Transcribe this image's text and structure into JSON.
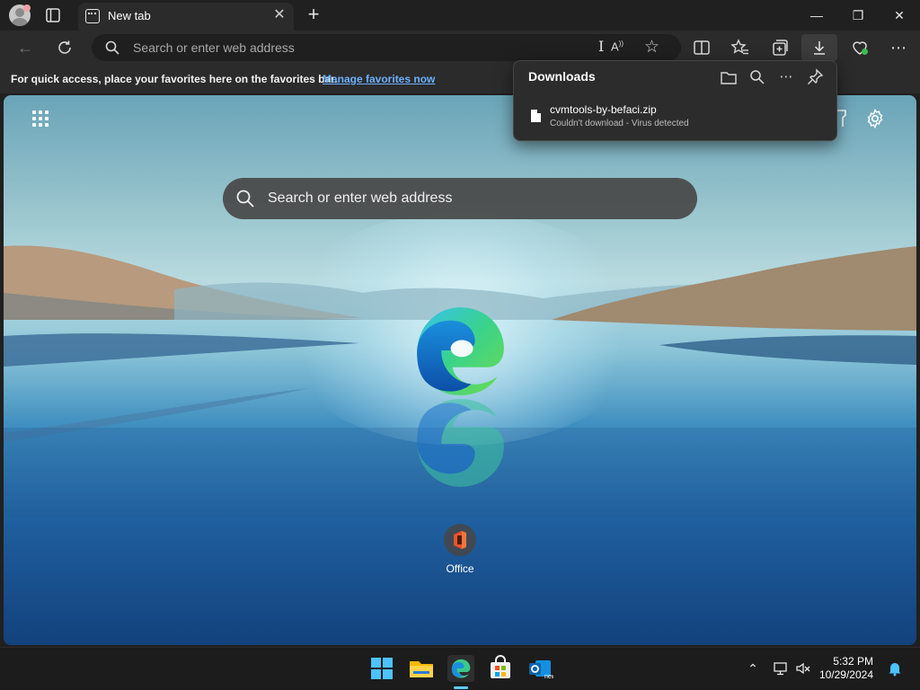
{
  "tab": {
    "title": "New tab",
    "close_glyph": "✕"
  },
  "toolbar": {
    "address_placeholder": "Search or enter web address",
    "icons": [
      "back-arrow-icon",
      "refresh-icon",
      "read-aloud-icon",
      "favorite-star-icon",
      "split-screen-icon",
      "favorites-icon",
      "collections-icon",
      "downloads-icon",
      "browser-essentials-icon",
      "more-icon"
    ]
  },
  "favorites_bar": {
    "message": "For quick access, place your favorites here on the favorites bar.",
    "link": "Manage favorites now"
  },
  "downloads": {
    "title": "Downloads",
    "item": {
      "filename": "cvmtools-by-befaci.zip",
      "status": "Couldn't download - Virus detected"
    }
  },
  "newtab": {
    "search_placeholder": "Search or enter web address",
    "quick_link": "Office"
  },
  "taskbar": {
    "time": "5:32 PM",
    "date": "10/29/2024",
    "pinned": [
      "windows-start-icon",
      "file-explorer-icon",
      "edge-icon",
      "microsoft-store-icon",
      "outlook-icon"
    ]
  },
  "colors": {
    "accent_link": "#6cb0ff",
    "taskbar_active_indicator": "#60cdff",
    "chrome_dark": "#202020",
    "toolbar": "#2b2b2b"
  }
}
